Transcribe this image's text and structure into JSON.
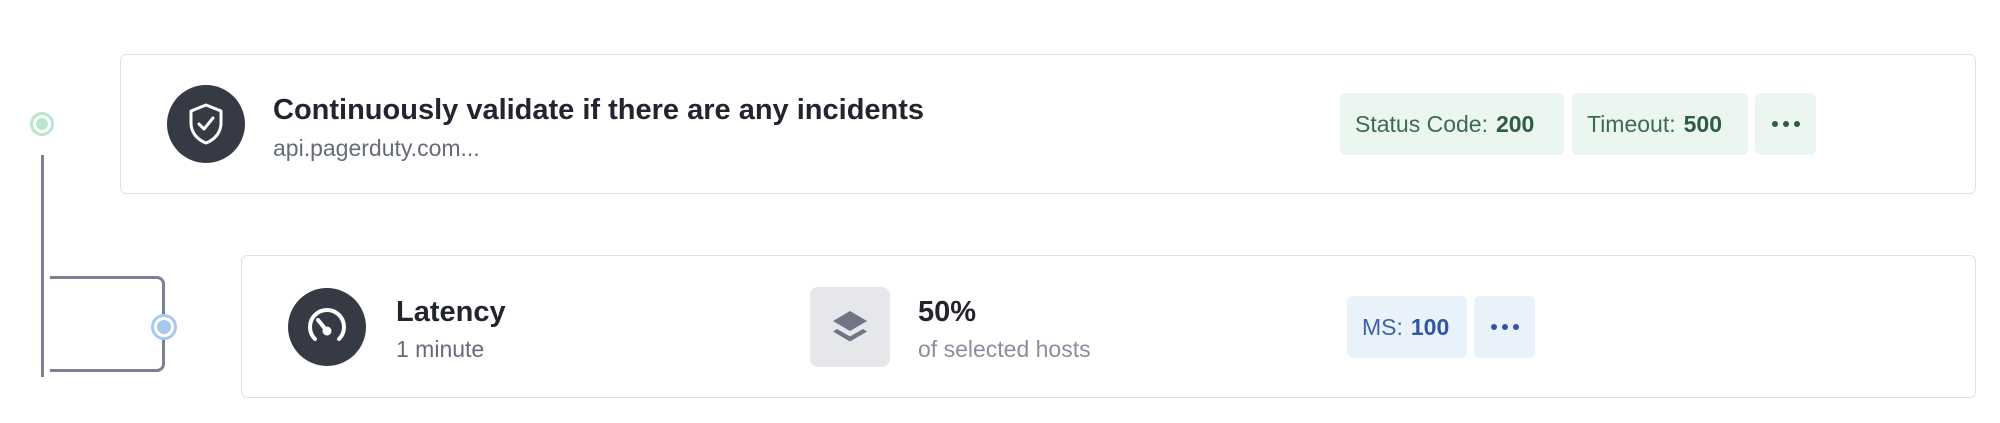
{
  "check": {
    "title": "Continuously validate if there are any incidents",
    "url": "api.pagerduty.com...",
    "icon": "shield-check-icon",
    "chips": {
      "status_label": "Status Code:",
      "status_value": "200",
      "timeout_label": "Timeout:",
      "timeout_value": "500"
    }
  },
  "metric": {
    "title": "Latency",
    "interval": "1 minute",
    "icon": "speedometer-icon",
    "hosts_percent": "50%",
    "hosts_label": "of selected hosts",
    "hosts_icon": "layers-icon",
    "chips": {
      "ms_label": "MS:",
      "ms_value": "100"
    }
  },
  "colors": {
    "green_chip_bg": "#eaf6ef",
    "blue_chip_bg": "#e9f1fb",
    "icon_circle": "#363a45",
    "timeline": "#7b8193"
  }
}
